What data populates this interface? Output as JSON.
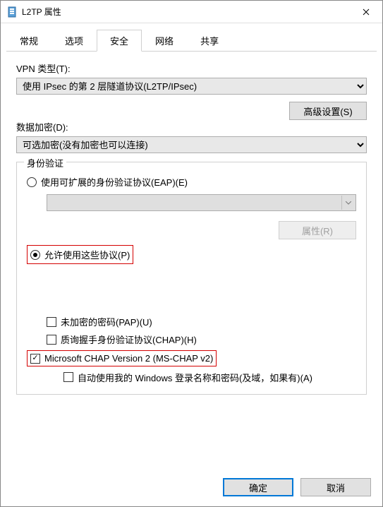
{
  "window": {
    "title": "L2TP 属性"
  },
  "tabs": {
    "items": [
      "常规",
      "选项",
      "安全",
      "网络",
      "共享"
    ],
    "active_index": 2
  },
  "vpn_type": {
    "label": "VPN 类型(T):",
    "value": "使用 IPsec 的第 2 层隧道协议(L2TP/IPsec)"
  },
  "advanced_btn": "高级设置(S)",
  "encryption": {
    "label": "数据加密(D):",
    "value": "可选加密(没有加密也可以连接)"
  },
  "auth": {
    "legend": "身份验证",
    "eap": {
      "label": "使用可扩展的身份验证协议(EAP)(E)",
      "checked": false
    },
    "eap_props_btn": "属性(R)",
    "allow_protocols": {
      "label": "允许使用这些协议(P)",
      "checked": true
    },
    "pap": {
      "label": "未加密的密码(PAP)(U)",
      "checked": false
    },
    "chap": {
      "label": "质询握手身份验证协议(CHAP)(H)",
      "checked": false
    },
    "mschap": {
      "label": "Microsoft CHAP Version 2 (MS-CHAP v2)",
      "checked": true
    },
    "auto_logon": {
      "label": "自动使用我的 Windows 登录名称和密码(及域，如果有)(A)",
      "checked": false
    }
  },
  "buttons": {
    "ok": "确定",
    "cancel": "取消"
  }
}
